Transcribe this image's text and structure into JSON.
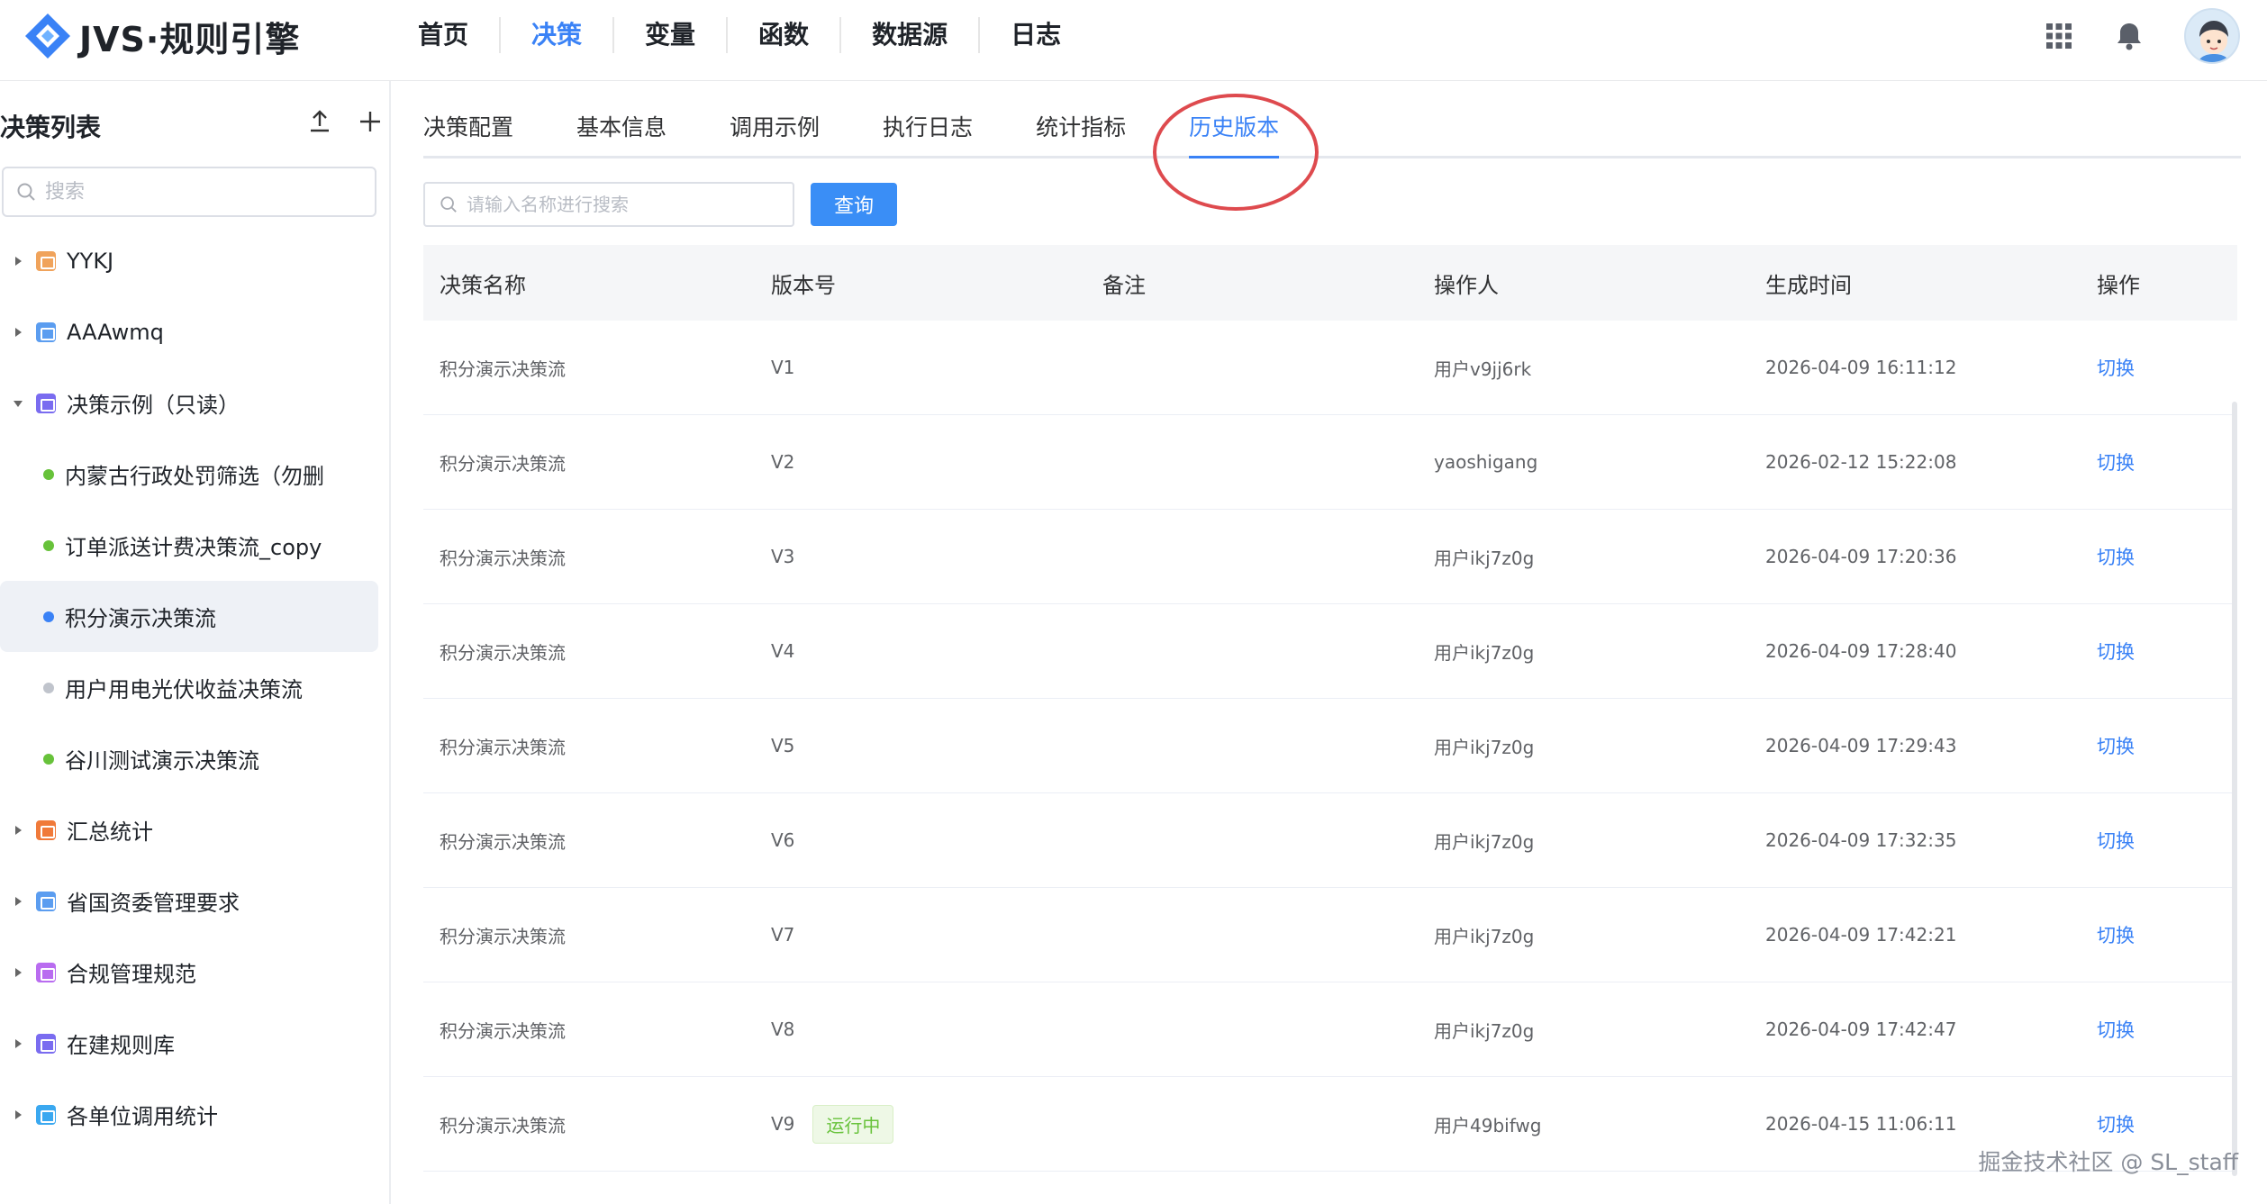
{
  "app": {
    "title": "JVS·规则引擎"
  },
  "nav": [
    {
      "label": "首页",
      "active": false
    },
    {
      "label": "决策",
      "active": true
    },
    {
      "label": "变量",
      "active": false
    },
    {
      "label": "函数",
      "active": false
    },
    {
      "label": "数据源",
      "active": false
    },
    {
      "label": "日志",
      "active": false
    }
  ],
  "sidebar": {
    "title": "决策列表",
    "search_placeholder": "搜索",
    "tree": [
      {
        "type": "folder",
        "label": "YYKJ",
        "color": "#f0a35b",
        "expanded": false
      },
      {
        "type": "folder",
        "label": "AAAwmq",
        "color": "#5b9df0",
        "expanded": false
      },
      {
        "type": "folder",
        "label": "决策示例（只读）",
        "color": "#7a6cf0",
        "expanded": true
      },
      {
        "type": "leaf",
        "label": "内蒙古行政处罚筛选（勿删",
        "dot": "#67c23a"
      },
      {
        "type": "leaf",
        "label": "订单派送计费决策流_copy",
        "dot": "#67c23a"
      },
      {
        "type": "leaf",
        "label": "积分演示决策流",
        "dot": "#3a82f6",
        "selected": true
      },
      {
        "type": "leaf",
        "label": "用户用电光伏收益决策流",
        "dot": "#c0c4cc"
      },
      {
        "type": "leaf",
        "label": "谷川测试演示决策流",
        "dot": "#67c23a"
      },
      {
        "type": "folder",
        "label": "汇总统计",
        "color": "#f07a3a",
        "expanded": false
      },
      {
        "type": "folder",
        "label": "省国资委管理要求",
        "color": "#5b9df0",
        "expanded": false
      },
      {
        "type": "folder",
        "label": "合规管理规范",
        "color": "#b96cf0",
        "expanded": false
      },
      {
        "type": "folder",
        "label": "在建规则库",
        "color": "#7a6cf0",
        "expanded": false
      },
      {
        "type": "folder",
        "label": "各单位调用统计",
        "color": "#3aa8f0",
        "expanded": false
      },
      {
        "type": "folder",
        "label": "",
        "color": "#5b9df0",
        "expanded": false
      }
    ]
  },
  "tabs": [
    {
      "label": "决策配置",
      "active": false
    },
    {
      "label": "基本信息",
      "active": false
    },
    {
      "label": "调用示例",
      "active": false
    },
    {
      "label": "执行日志",
      "active": false
    },
    {
      "label": "统计指标",
      "active": false
    },
    {
      "label": "历史版本",
      "active": true
    }
  ],
  "filter": {
    "placeholder": "请输入名称进行搜索",
    "query_label": "查询"
  },
  "table": {
    "columns": [
      "决策名称",
      "版本号",
      "备注",
      "操作人",
      "生成时间",
      "操作"
    ],
    "rows": [
      {
        "name": "积分演示决策流",
        "version": "V1",
        "note": "",
        "operator": "用户v9jj6rk",
        "time": "2026-04-09 16:11:12",
        "action": "切换",
        "status": ""
      },
      {
        "name": "积分演示决策流",
        "version": "V2",
        "note": "",
        "operator": "yaoshigang",
        "time": "2026-02-12 15:22:08",
        "action": "切换",
        "status": ""
      },
      {
        "name": "积分演示决策流",
        "version": "V3",
        "note": "",
        "operator": "用户ikj7z0g",
        "time": "2026-04-09 17:20:36",
        "action": "切换",
        "status": ""
      },
      {
        "name": "积分演示决策流",
        "version": "V4",
        "note": "",
        "operator": "用户ikj7z0g",
        "time": "2026-04-09 17:28:40",
        "action": "切换",
        "status": ""
      },
      {
        "name": "积分演示决策流",
        "version": "V5",
        "note": "",
        "operator": "用户ikj7z0g",
        "time": "2026-04-09 17:29:43",
        "action": "切换",
        "status": ""
      },
      {
        "name": "积分演示决策流",
        "version": "V6",
        "note": "",
        "operator": "用户ikj7z0g",
        "time": "2026-04-09 17:32:35",
        "action": "切换",
        "status": ""
      },
      {
        "name": "积分演示决策流",
        "version": "V7",
        "note": "",
        "operator": "用户ikj7z0g",
        "time": "2026-04-09 17:42:21",
        "action": "切换",
        "status": ""
      },
      {
        "name": "积分演示决策流",
        "version": "V8",
        "note": "",
        "operator": "用户ikj7z0g",
        "time": "2026-04-09 17:42:47",
        "action": "切换",
        "status": ""
      },
      {
        "name": "积分演示决策流",
        "version": "V9",
        "note": "",
        "operator": "用户49bifwg",
        "time": "2026-04-15 11:06:11",
        "action": "切换",
        "status": "运行中"
      }
    ]
  },
  "watermark": "掘金技术社区 @ SL_staff",
  "colors": {
    "accent": "#3a82f6",
    "highlight_ring": "#de4a4e",
    "running": "#67c23a"
  }
}
